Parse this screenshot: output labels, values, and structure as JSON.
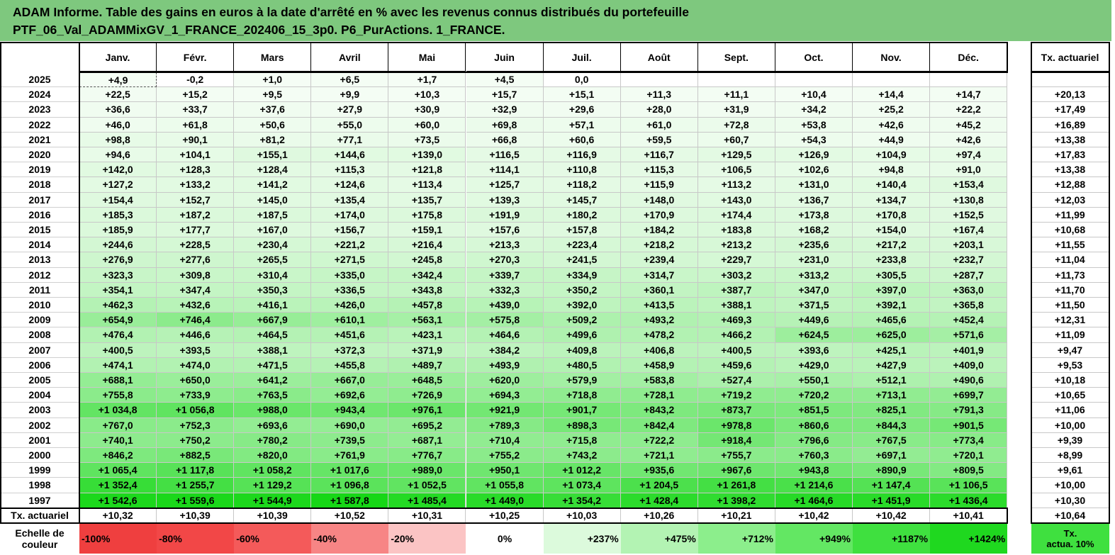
{
  "title": {
    "line1": "ADAM Informe. Table des gains en euros à la date d'arrêté en % avec les revenus connus distribués du portefeuille",
    "line2": "PTF_06_Val_ADAMMixGV_1_FRANCE_202406_15_3p0. P6_PurActions. 1_FRANCE."
  },
  "months": [
    "Janv.",
    "Févr.",
    "Mars",
    "Avril",
    "Mai",
    "Juin",
    "Juil.",
    "Août",
    "Sept.",
    "Oct.",
    "Nov.",
    "Déc."
  ],
  "rate_header": "Tx. actuariel",
  "rows": [
    {
      "year": "2025",
      "values": [
        "+4,9",
        "-0,2",
        "+1,0",
        "+6,5",
        "+1,7",
        "+4,5",
        "0,0",
        "",
        "",
        "",
        "",
        ""
      ],
      "rate": ""
    },
    {
      "year": "2024",
      "values": [
        "+22,5",
        "+15,2",
        "+9,5",
        "+9,9",
        "+10,3",
        "+15,7",
        "+15,1",
        "+11,3",
        "+11,1",
        "+10,4",
        "+14,4",
        "+14,7"
      ],
      "rate": "+20,13"
    },
    {
      "year": "2023",
      "values": [
        "+36,6",
        "+33,7",
        "+37,6",
        "+27,9",
        "+30,9",
        "+32,9",
        "+29,6",
        "+28,0",
        "+31,9",
        "+34,2",
        "+25,2",
        "+22,2"
      ],
      "rate": "+17,49"
    },
    {
      "year": "2022",
      "values": [
        "+46,0",
        "+61,8",
        "+50,6",
        "+55,0",
        "+60,0",
        "+69,8",
        "+57,1",
        "+61,0",
        "+72,8",
        "+53,8",
        "+42,6",
        "+45,2"
      ],
      "rate": "+16,89"
    },
    {
      "year": "2021",
      "values": [
        "+98,8",
        "+90,1",
        "+81,2",
        "+77,1",
        "+73,5",
        "+66,8",
        "+60,6",
        "+59,5",
        "+60,7",
        "+54,3",
        "+44,9",
        "+42,6"
      ],
      "rate": "+13,38"
    },
    {
      "year": "2020",
      "values": [
        "+94,6",
        "+104,1",
        "+155,1",
        "+144,6",
        "+139,0",
        "+116,5",
        "+116,9",
        "+116,7",
        "+129,5",
        "+126,9",
        "+104,9",
        "+97,4"
      ],
      "rate": "+17,83"
    },
    {
      "year": "2019",
      "values": [
        "+142,0",
        "+128,3",
        "+128,4",
        "+115,3",
        "+121,8",
        "+114,1",
        "+110,8",
        "+115,3",
        "+106,5",
        "+102,6",
        "+94,8",
        "+91,0"
      ],
      "rate": "+13,38"
    },
    {
      "year": "2018",
      "values": [
        "+127,2",
        "+133,2",
        "+141,2",
        "+124,6",
        "+113,4",
        "+125,7",
        "+118,2",
        "+115,9",
        "+113,2",
        "+131,0",
        "+140,4",
        "+153,4"
      ],
      "rate": "+12,88"
    },
    {
      "year": "2017",
      "values": [
        "+154,4",
        "+152,7",
        "+145,0",
        "+135,4",
        "+135,7",
        "+139,3",
        "+145,7",
        "+148,0",
        "+143,0",
        "+136,7",
        "+134,7",
        "+130,8"
      ],
      "rate": "+12,03"
    },
    {
      "year": "2016",
      "values": [
        "+185,3",
        "+187,2",
        "+187,5",
        "+174,0",
        "+175,8",
        "+191,9",
        "+180,2",
        "+170,9",
        "+174,4",
        "+173,8",
        "+170,8",
        "+152,5"
      ],
      "rate": "+11,99"
    },
    {
      "year": "2015",
      "values": [
        "+185,9",
        "+177,7",
        "+167,0",
        "+156,7",
        "+159,1",
        "+157,6",
        "+157,8",
        "+184,2",
        "+183,8",
        "+168,2",
        "+154,0",
        "+167,4"
      ],
      "rate": "+10,68"
    },
    {
      "year": "2014",
      "values": [
        "+244,6",
        "+228,5",
        "+230,4",
        "+221,2",
        "+216,4",
        "+213,3",
        "+223,4",
        "+218,2",
        "+213,2",
        "+235,6",
        "+217,2",
        "+203,1"
      ],
      "rate": "+11,55"
    },
    {
      "year": "2013",
      "values": [
        "+276,9",
        "+277,6",
        "+265,5",
        "+271,5",
        "+245,8",
        "+270,3",
        "+241,5",
        "+239,4",
        "+229,7",
        "+231,0",
        "+233,8",
        "+232,7"
      ],
      "rate": "+11,04"
    },
    {
      "year": "2012",
      "values": [
        "+323,3",
        "+309,8",
        "+310,4",
        "+335,0",
        "+342,4",
        "+339,7",
        "+334,9",
        "+314,7",
        "+303,2",
        "+313,2",
        "+305,5",
        "+287,7"
      ],
      "rate": "+11,73"
    },
    {
      "year": "2011",
      "values": [
        "+354,1",
        "+347,4",
        "+350,3",
        "+336,5",
        "+343,8",
        "+332,3",
        "+350,2",
        "+360,1",
        "+387,7",
        "+347,0",
        "+397,0",
        "+363,0"
      ],
      "rate": "+11,70"
    },
    {
      "year": "2010",
      "values": [
        "+462,3",
        "+432,6",
        "+416,1",
        "+426,0",
        "+457,8",
        "+439,0",
        "+392,0",
        "+413,5",
        "+388,1",
        "+371,5",
        "+392,1",
        "+365,8"
      ],
      "rate": "+11,50"
    },
    {
      "year": "2009",
      "values": [
        "+654,9",
        "+746,4",
        "+667,9",
        "+610,1",
        "+563,1",
        "+575,8",
        "+509,2",
        "+493,2",
        "+469,3",
        "+449,6",
        "+465,6",
        "+452,4"
      ],
      "rate": "+12,31"
    },
    {
      "year": "2008",
      "values": [
        "+476,4",
        "+446,6",
        "+464,5",
        "+451,6",
        "+423,1",
        "+464,6",
        "+499,6",
        "+478,2",
        "+466,2",
        "+624,5",
        "+625,0",
        "+571,6"
      ],
      "rate": "+11,09"
    },
    {
      "year": "2007",
      "values": [
        "+400,5",
        "+393,5",
        "+388,1",
        "+372,3",
        "+371,9",
        "+384,2",
        "+409,8",
        "+406,8",
        "+400,5",
        "+393,6",
        "+425,1",
        "+401,9"
      ],
      "rate": "+9,47"
    },
    {
      "year": "2006",
      "values": [
        "+474,1",
        "+474,0",
        "+471,5",
        "+455,8",
        "+489,7",
        "+493,9",
        "+480,5",
        "+458,9",
        "+459,6",
        "+429,0",
        "+427,9",
        "+409,0"
      ],
      "rate": "+9,53"
    },
    {
      "year": "2005",
      "values": [
        "+688,1",
        "+650,0",
        "+641,2",
        "+667,0",
        "+648,5",
        "+620,0",
        "+579,9",
        "+583,8",
        "+527,4",
        "+550,1",
        "+512,1",
        "+490,6"
      ],
      "rate": "+10,18"
    },
    {
      "year": "2004",
      "values": [
        "+755,8",
        "+733,9",
        "+763,5",
        "+692,6",
        "+726,9",
        "+694,3",
        "+718,8",
        "+728,1",
        "+719,2",
        "+720,2",
        "+713,1",
        "+699,7"
      ],
      "rate": "+10,65"
    },
    {
      "year": "2003",
      "values": [
        "+1 034,8",
        "+1 056,8",
        "+988,0",
        "+943,4",
        "+976,1",
        "+921,9",
        "+901,7",
        "+843,2",
        "+873,7",
        "+851,5",
        "+825,1",
        "+791,3"
      ],
      "rate": "+11,06"
    },
    {
      "year": "2002",
      "values": [
        "+767,0",
        "+752,3",
        "+693,6",
        "+690,0",
        "+695,2",
        "+789,3",
        "+898,3",
        "+842,4",
        "+978,8",
        "+860,6",
        "+844,3",
        "+901,5"
      ],
      "rate": "+10,00"
    },
    {
      "year": "2001",
      "values": [
        "+740,1",
        "+750,2",
        "+780,2",
        "+739,5",
        "+687,1",
        "+710,4",
        "+715,8",
        "+722,2",
        "+918,4",
        "+796,6",
        "+767,5",
        "+773,4"
      ],
      "rate": "+9,39"
    },
    {
      "year": "2000",
      "values": [
        "+846,2",
        "+882,5",
        "+820,0",
        "+761,9",
        "+776,7",
        "+755,2",
        "+743,2",
        "+721,1",
        "+755,7",
        "+760,3",
        "+697,1",
        "+720,1"
      ],
      "rate": "+8,99"
    },
    {
      "year": "1999",
      "values": [
        "+1 065,4",
        "+1 117,8",
        "+1 058,2",
        "+1 017,6",
        "+989,0",
        "+950,1",
        "+1 012,2",
        "+935,6",
        "+967,6",
        "+943,8",
        "+890,9",
        "+809,5"
      ],
      "rate": "+9,61"
    },
    {
      "year": "1998",
      "values": [
        "+1 352,4",
        "+1 255,7",
        "+1 129,2",
        "+1 096,8",
        "+1 052,5",
        "+1 055,8",
        "+1 073,4",
        "+1 204,5",
        "+1 261,8",
        "+1 214,6",
        "+1 147,4",
        "+1 106,5"
      ],
      "rate": "+10,00"
    },
    {
      "year": "1997",
      "values": [
        "+1 542,6",
        "+1 559,6",
        "+1 544,9",
        "+1 587,8",
        "+1 485,4",
        "+1 449,0",
        "+1 354,2",
        "+1 428,4",
        "+1 398,2",
        "+1 464,6",
        "+1 451,9",
        "+1 436,4"
      ],
      "rate": "+10,30"
    }
  ],
  "footer": {
    "label": "Tx. actuariel",
    "values": [
      "+10,32",
      "+10,39",
      "+10,39",
      "+10,52",
      "+10,31",
      "+10,25",
      "+10,03",
      "+10,26",
      "+10,21",
      "+10,42",
      "+10,42",
      "+10,41"
    ],
    "rate": "+10,64"
  },
  "scale": {
    "label_line1": "Echelle de",
    "label_line2": "couleur",
    "items": [
      {
        "text": "-100%",
        "color": "#ef3f3f",
        "align": "left"
      },
      {
        "text": "-80%",
        "color": "#f24747",
        "align": "left"
      },
      {
        "text": "-60%",
        "color": "#f45a5a",
        "align": "left"
      },
      {
        "text": "-40%",
        "color": "#f78585",
        "align": "left"
      },
      {
        "text": "-20%",
        "color": "#fbc4c4",
        "align": "left"
      },
      {
        "text": "0%",
        "color": "#ffffff",
        "align": "center"
      },
      {
        "text": "+237%",
        "color": "#dcfadc",
        "align": "right"
      },
      {
        "text": "+475%",
        "color": "#b3f3b3",
        "align": "right"
      },
      {
        "text": "+712%",
        "color": "#8cee8c",
        "align": "right"
      },
      {
        "text": "+949%",
        "color": "#63e763",
        "align": "right"
      },
      {
        "text": "+1187%",
        "color": "#3fe03f",
        "align": "right"
      },
      {
        "text": "+1424%",
        "color": "#1fd81f",
        "align": "right"
      }
    ],
    "rate_line1": "Tx.",
    "rate_line2": "actua. 10%",
    "rate_color": "#3fe03f"
  },
  "colors": {
    "title_bg": "#7ec87e",
    "max_green": "#1fd81f"
  }
}
